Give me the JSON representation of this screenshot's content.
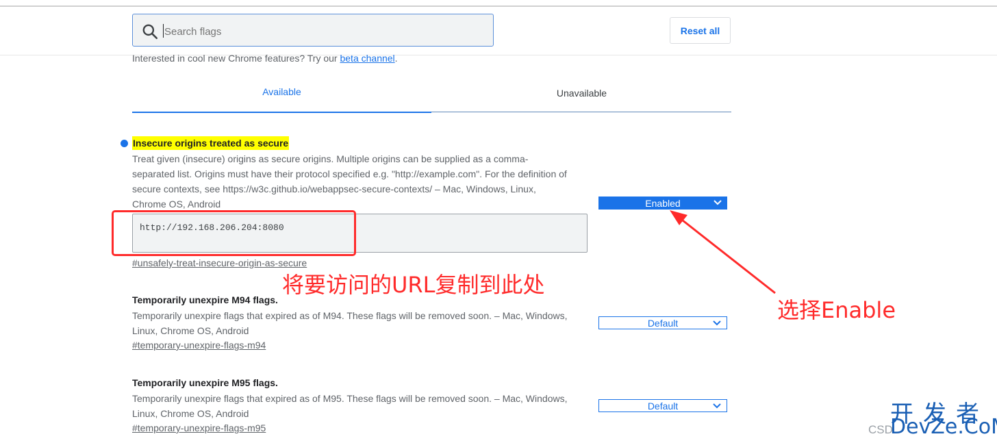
{
  "search": {
    "placeholder": "Search flags",
    "value": ""
  },
  "header": {
    "reset_label": "Reset all"
  },
  "intro": {
    "text": "Interested in cool new Chrome features? Try our ",
    "link": "beta channel",
    "suffix": "."
  },
  "tabs": [
    {
      "label": "Available",
      "active": true
    },
    {
      "label": "Unavailable",
      "active": false
    }
  ],
  "flags": [
    {
      "title": "Insecure origins treated as secure",
      "desc": "Treat given (insecure) origins as secure origins. Multiple origins can be supplied as a comma-separated list. Origins must have their protocol specified e.g. \"http://example.com\". For the definition of secure contexts, see https://w3c.github.io/webappsec-secure-contexts/ – Mac, Windows, Linux, Chrome OS, Android",
      "input_value": "http://192.168.206.204:8080",
      "link": "#unsafely-treat-insecure-origin-as-secure",
      "select_value": "Enabled"
    },
    {
      "title": "Temporarily unexpire M94 flags.",
      "desc": "Temporarily unexpire flags that expired as of M94. These flags will be removed soon. – Mac, Windows, Linux, Chrome OS, Android",
      "link": "#temporary-unexpire-flags-m94",
      "select_value": "Default"
    },
    {
      "title": "Temporarily unexpire M95 flags.",
      "desc": "Temporarily unexpire flags that expired as of M95. These flags will be removed soon. – Mac, Windows, Linux, Chrome OS, Android",
      "link": "#temporary-unexpire-flags-m95",
      "select_value": "Default"
    }
  ],
  "annotations": {
    "url_hint": "将要访问的URL复制到此处",
    "enable_hint": "选择Enable"
  },
  "watermark": {
    "cn": "开发者",
    "en": "DevZe.CoM",
    "partial": "CSD"
  },
  "colors": {
    "accent": "#1a73e8",
    "annotation": "#ff2a2a",
    "highlight": "#ffff00"
  },
  "icons": {
    "search": "search-icon",
    "dropdown": "chevron-down-icon"
  }
}
